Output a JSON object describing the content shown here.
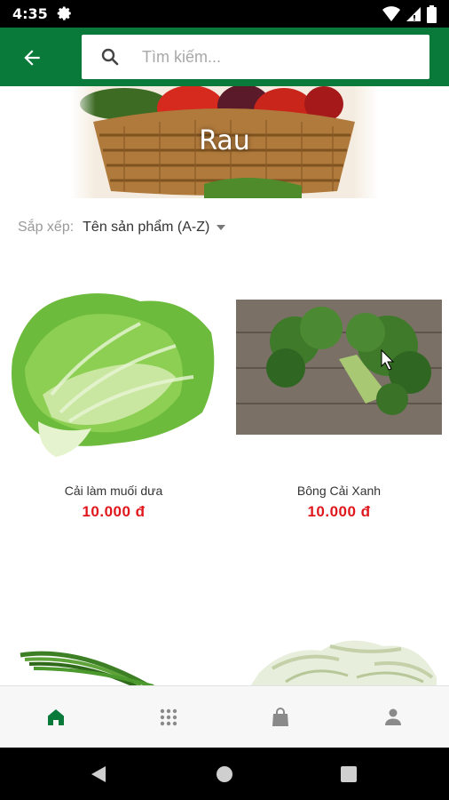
{
  "status_bar": {
    "time": "4:35",
    "icons": [
      "gear-icon",
      "wifi-icon",
      "signal-icon",
      "battery-icon"
    ]
  },
  "header": {
    "back_icon": "arrow-left-icon",
    "search_placeholder": "Tìm kiếm..."
  },
  "banner": {
    "title": "Rau"
  },
  "sort": {
    "label": "Sắp xếp:",
    "selected": "Tên sản phẩm (A-Z)"
  },
  "products": [
    {
      "name": "Cải làm muối dưa",
      "price": "10.000 đ"
    },
    {
      "name": "Bông Cải Xanh",
      "price": "10.000 đ"
    },
    {
      "name": "",
      "price": ""
    },
    {
      "name": "",
      "price": ""
    }
  ],
  "bottom_nav": {
    "items": [
      "home-icon",
      "categories-grid-icon",
      "shopping-bag-icon",
      "account-icon"
    ],
    "active": "home-icon"
  },
  "colors": {
    "brand_green": "#0a7a3b",
    "price_red": "#e0181e"
  }
}
